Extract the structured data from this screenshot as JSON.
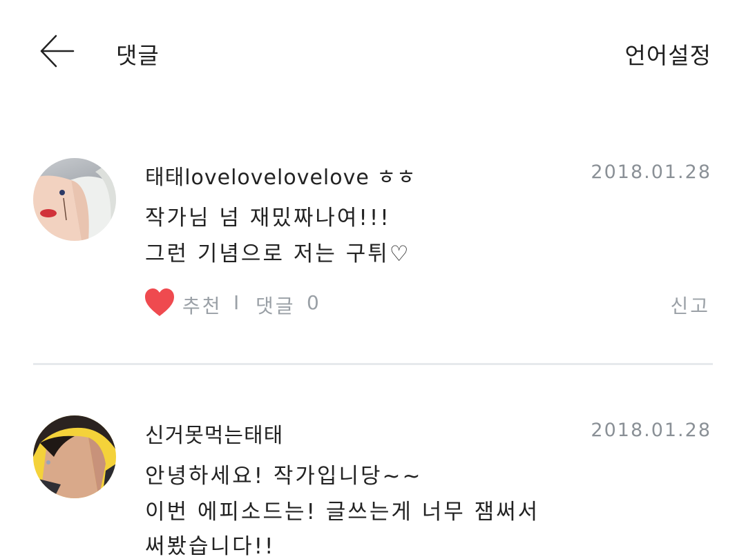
{
  "header": {
    "title": "댓글",
    "language_setting": "언어설정"
  },
  "comments": [
    {
      "username": "태태lovelovelovelove ㅎㅎ",
      "date": "2018.01.28",
      "lines": [
        "작가님 넘 재밌짜나여!!!",
        "그런 기념으로 저는 구튀♡"
      ],
      "recommend_label": "추천",
      "separator": "I",
      "reply_label": "댓글",
      "reply_count": "0",
      "report_label": "신고"
    },
    {
      "username": "신거못먹는태태",
      "date": "2018.01.28",
      "lines": [
        "안녕하세요! 작가입니당~~",
        "이번 에피소드는! 글쓰는게 너무 잼써서",
        "써봤습니다!!"
      ]
    }
  ],
  "colors": {
    "heart": "#ef4a4f",
    "meta_text": "#9aa0a6",
    "date_text": "#8a9096",
    "divider": "#e6e9ec"
  },
  "icons": {
    "back": "arrow-left-icon",
    "heart": "heart-icon"
  }
}
